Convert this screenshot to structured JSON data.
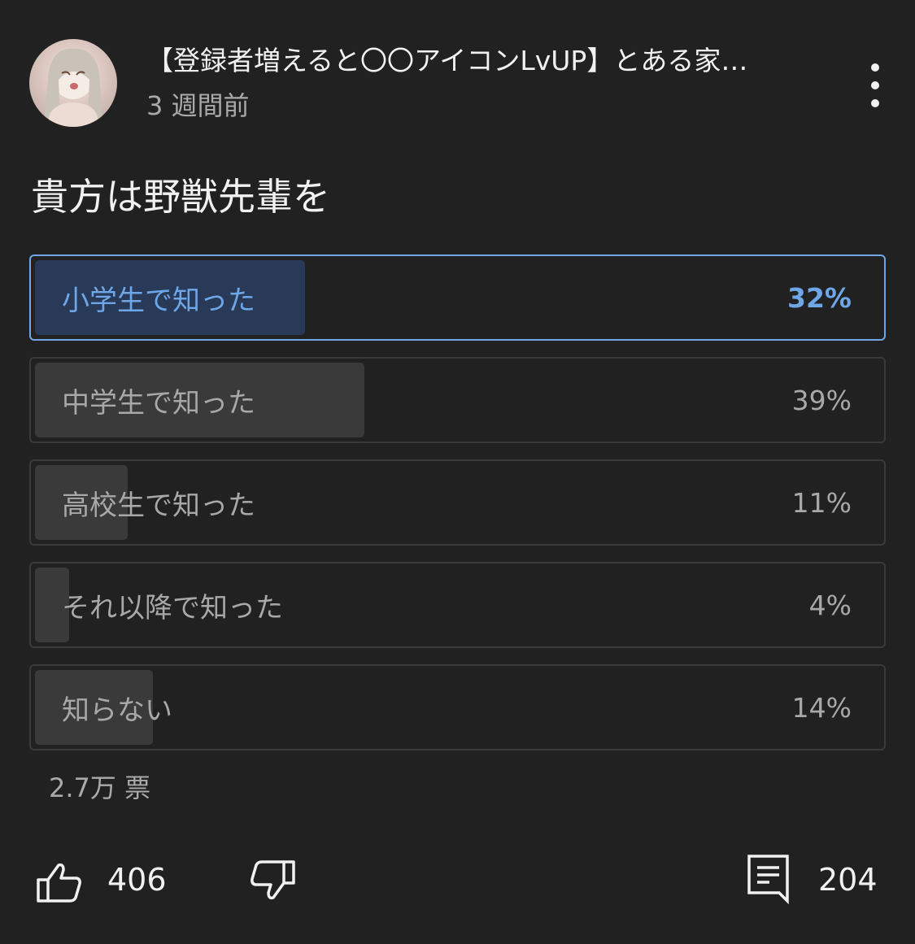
{
  "post": {
    "channel_name": "【登録者増えると〇〇アイコンLvUP】とある家…",
    "time_ago": "3 週間前",
    "menu_icon": "more-vertical-icon"
  },
  "poll": {
    "question": "貴方は野獣先輩を",
    "options": [
      {
        "label": "小学生で知った",
        "percent_text": "32%",
        "percent": 32,
        "selected": true
      },
      {
        "label": "中学生で知った",
        "percent_text": "39%",
        "percent": 39,
        "selected": false
      },
      {
        "label": "高校生で知った",
        "percent_text": "11%",
        "percent": 11,
        "selected": false
      },
      {
        "label": "それ以降で知った",
        "percent_text": "4%",
        "percent": 4,
        "selected": false
      },
      {
        "label": "知らない",
        "percent_text": "14%",
        "percent": 14,
        "selected": false
      }
    ],
    "total_votes": "2.7万 票"
  },
  "actions": {
    "like_icon": "thumbs-up-icon",
    "like_count": "406",
    "dislike_icon": "thumbs-down-icon",
    "comment_icon": "comment-icon",
    "comment_count": "204"
  },
  "colors": {
    "background": "#212121",
    "accent": "#6ea6e8",
    "selected_fill": "#283a57",
    "bar_fill": "#3a3a3a",
    "muted_text": "#aaaaaa"
  }
}
